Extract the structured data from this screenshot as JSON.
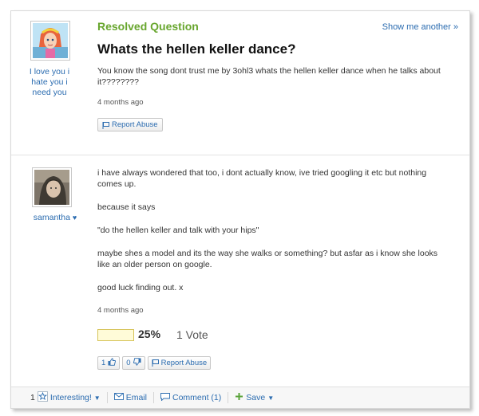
{
  "question": {
    "status": "Resolved Question",
    "show_another": "Show me another »",
    "asker": "I love you i hate you i need you",
    "title": "Whats the hellen keller dance?",
    "body": "You know the song dont trust me by 3ohl3 whats the hellen keller dance when he talks about it????????",
    "time_ago": "4 months ago",
    "report_label": "Report Abuse"
  },
  "answer": {
    "user": "samantha",
    "heart": "♥",
    "paragraphs": [
      "i have always wondered that too, i dont actually know, ive tried googling it etc but nothing comes up.",
      "because it says",
      "\"do the hellen keller and talk with your hips\"",
      "maybe shes a model and its the way she walks or something? but asfar as i know she looks like an older person on google.",
      "good luck finding out. x"
    ],
    "time_ago": "4 months ago",
    "vote_fraction": 0.25,
    "vote_percent": "25%",
    "vote_count": "1 Vote",
    "thumbs_up_count": "1",
    "thumbs_down_count": "0",
    "report_label": "Report Abuse"
  },
  "toolbar": {
    "interesting_count": "1",
    "interesting_label": "Interesting!",
    "email_label": "Email",
    "comment_label": "Comment (1)",
    "save_label": "Save"
  },
  "icons": {
    "star": "star-icon",
    "email": "envelope-icon",
    "comment": "comment-icon",
    "save": "plus-icon",
    "flag": "flag-icon",
    "thumbs_up": "thumbs-up-icon",
    "thumbs_down": "thumbs-down-icon"
  },
  "colors": {
    "link": "#2b6cb0",
    "resolved": "#68a62e",
    "vote_fill": "#fffbd8"
  }
}
